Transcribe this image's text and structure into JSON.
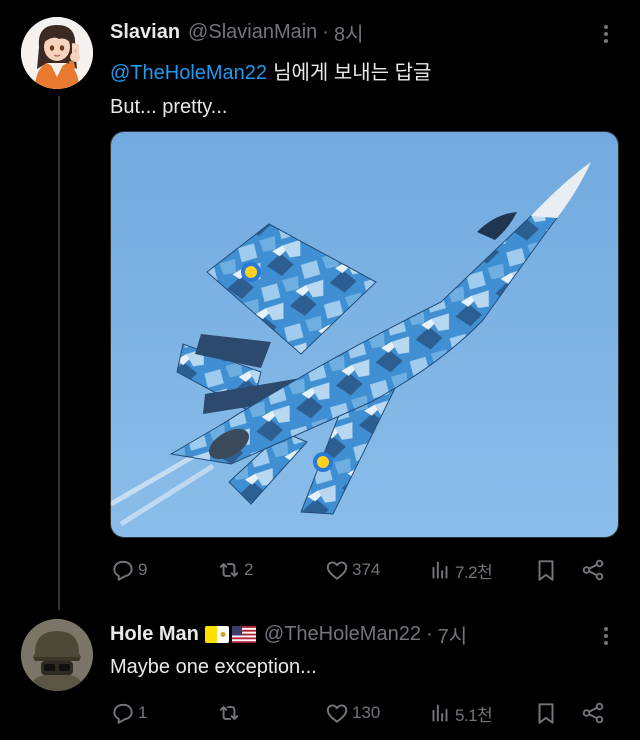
{
  "colors": {
    "background": "#000000",
    "text": "#e7e9ea",
    "muted": "#71767b",
    "link": "#1d9bf0",
    "thread_line": "#333639",
    "sky": "#7cb1e3"
  },
  "tweets": [
    {
      "display_name": "Slavian",
      "handle": "@SlavianMain",
      "separator": "·",
      "time": "8시",
      "reply_to": "@TheHoleMan22",
      "reply_suffix": "님에게 보내는 답글",
      "text": "But... pretty...",
      "media": "image: Su-27 jet in blue digital camouflage with yellow-blue roundels against sky",
      "metrics": {
        "replies": "9",
        "retweets": "2",
        "likes": "374",
        "views": "7.2천"
      }
    },
    {
      "display_name": "Hole Man",
      "flags": [
        "vatican-flag-icon",
        "us-flag-icon"
      ],
      "handle": "@TheHoleMan22",
      "separator": "·",
      "time": "7시",
      "text": "Maybe one exception...",
      "metrics": {
        "replies": "1",
        "retweets": "",
        "likes": "130",
        "views": "5.1천"
      }
    }
  ]
}
